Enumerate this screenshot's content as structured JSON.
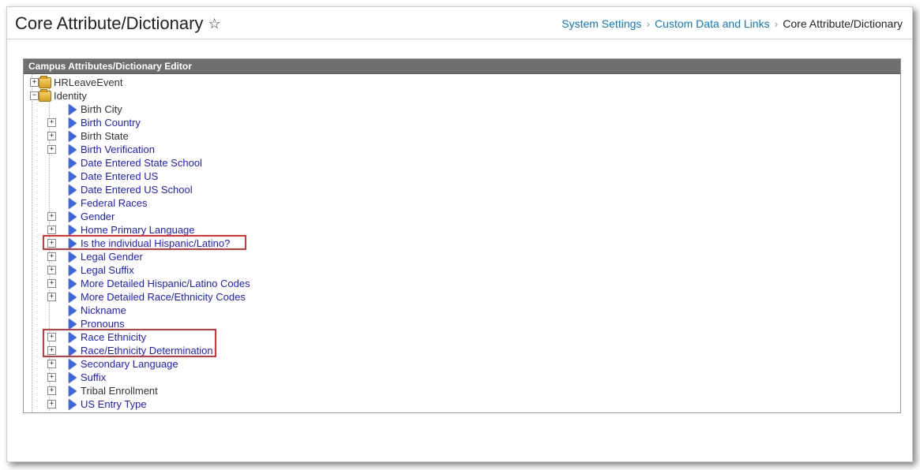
{
  "header": {
    "title": "Core Attribute/Dictionary"
  },
  "breadcrumb": {
    "items": [
      {
        "label": "System Settings",
        "link": true
      },
      {
        "label": "Custom Data and Links",
        "link": true
      },
      {
        "label": "Core Attribute/Dictionary",
        "link": false
      }
    ]
  },
  "panel": {
    "title": "Campus Attributes/Dictionary Editor"
  },
  "tree": {
    "root": [
      {
        "label": "HRLeaveEvent",
        "icon": "folder",
        "expander": "plus",
        "link": false
      },
      {
        "label": "Identity",
        "icon": "folder",
        "expander": "minus",
        "link": false
      }
    ],
    "identity_children": [
      {
        "label": "Birth City",
        "expander": "none",
        "link": false
      },
      {
        "label": "Birth Country",
        "expander": "plus",
        "link": true
      },
      {
        "label": "Birth State",
        "expander": "plus",
        "link": false
      },
      {
        "label": "Birth Verification",
        "expander": "plus",
        "link": true
      },
      {
        "label": "Date Entered State School",
        "expander": "none",
        "link": true
      },
      {
        "label": "Date Entered US",
        "expander": "none",
        "link": true
      },
      {
        "label": "Date Entered US School",
        "expander": "none",
        "link": true
      },
      {
        "label": "Federal Races",
        "expander": "none",
        "link": true
      },
      {
        "label": "Gender",
        "expander": "plus",
        "link": true
      },
      {
        "label": "Home Primary Language",
        "expander": "plus",
        "link": true
      },
      {
        "label": "Is the individual Hispanic/Latino?",
        "expander": "plus",
        "link": true
      },
      {
        "label": "Legal Gender",
        "expander": "plus",
        "link": true
      },
      {
        "label": "Legal Suffix",
        "expander": "plus",
        "link": true
      },
      {
        "label": "More Detailed Hispanic/Latino Codes",
        "expander": "plus",
        "link": true
      },
      {
        "label": "More Detailed Race/Ethnicity Codes",
        "expander": "plus",
        "link": true
      },
      {
        "label": "Nickname",
        "expander": "none",
        "link": true
      },
      {
        "label": "Pronouns",
        "expander": "none",
        "link": true
      },
      {
        "label": "Race Ethnicity",
        "expander": "plus",
        "link": true
      },
      {
        "label": "Race/Ethnicity Determination",
        "expander": "plus",
        "link": true
      },
      {
        "label": "Secondary Language",
        "expander": "plus",
        "link": true
      },
      {
        "label": "Suffix",
        "expander": "plus",
        "link": true
      },
      {
        "label": "Tribal Enrollment",
        "expander": "plus",
        "link": false
      },
      {
        "label": "US Entry Type",
        "expander": "plus",
        "link": true
      }
    ]
  }
}
